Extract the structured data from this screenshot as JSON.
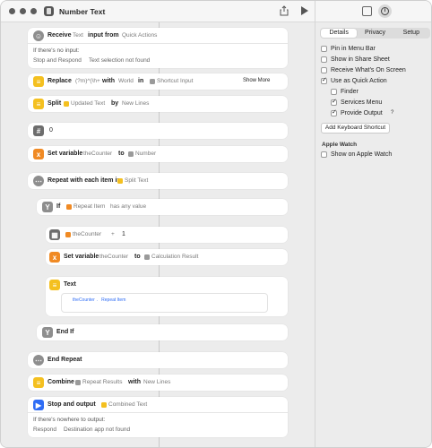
{
  "window": {
    "title": "Number Text"
  },
  "inspector": {
    "tabs": [
      "Details",
      "Privacy",
      "Setup"
    ],
    "active_tab": "Details",
    "options": {
      "pin_menu_bar": {
        "label": "Pin in Menu Bar",
        "checked": false
      },
      "show_share_sheet": {
        "label": "Show in Share Sheet",
        "checked": false
      },
      "receive_on_screen": {
        "label": "Receive What's On Screen",
        "checked": false
      },
      "use_quick_action": {
        "label": "Use as Quick Action",
        "checked": true
      },
      "finder": {
        "label": "Finder",
        "checked": false
      },
      "services_menu": {
        "label": "Services Menu",
        "checked": true
      },
      "provide_output": {
        "label": "Provide Output",
        "checked": true
      },
      "provide_output_help": "?",
      "show_apple_watch": {
        "label": "Show on Apple Watch",
        "checked": false
      }
    },
    "add_shortcut_label": "Add Keyboard Shortcut",
    "apple_watch_heading": "Apple Watch"
  },
  "actions": {
    "receive": {
      "label": "Receive",
      "type": "Text",
      "mid": "input from",
      "source": "Quick Actions",
      "no_input_label": "If there's no input:",
      "no_input_action": "Stop and Respond",
      "no_input_message": "Text selection not found"
    },
    "replace": {
      "label": "Replace",
      "pattern": "(?m)^(\\h+",
      "with": "with",
      "replacement": "World",
      "in": "in",
      "target": "Shortcut Input",
      "more": "Show More"
    },
    "split": {
      "label": "Split",
      "input": "Updated Text",
      "by": "by",
      "separator": "New Lines"
    },
    "number": {
      "value": "0"
    },
    "set_var1": {
      "label": "Set variable",
      "var": "theCounter",
      "to": "to",
      "value": "Number"
    },
    "repeat": {
      "label": "Repeat with each item in",
      "list": "Split Text"
    },
    "if": {
      "label": "If",
      "item": "Repeat Item",
      "cond": "has any value"
    },
    "calc": {
      "var": "theCounter",
      "op": "+",
      "num": "1"
    },
    "set_var2": {
      "label": "Set variable",
      "var": "theCounter",
      "to": "to",
      "value": "Calculation Result"
    },
    "text": {
      "label": "Text",
      "var1": "theCounter",
      "sep": ".",
      "var2": "Repeat Item"
    },
    "end_if": {
      "label": "End If"
    },
    "end_repeat": {
      "label": "End Repeat"
    },
    "combine": {
      "label": "Combine",
      "input": "Repeat Results",
      "with": "with",
      "sep": "New Lines"
    },
    "stop": {
      "label": "Stop and output",
      "output": "Combined Text",
      "nowhere_label": "If there's nowhere to output:",
      "nowhere_action": "Respond",
      "nowhere_message": "Destination app not found"
    }
  },
  "colors": {
    "yellow": "#f4c020",
    "orange": "#f08a24",
    "gray": "#8e8e8e",
    "blue": "#2f6df5"
  },
  "icons": [
    "share-icon",
    "play-icon",
    "library-icon",
    "info-icon"
  ]
}
